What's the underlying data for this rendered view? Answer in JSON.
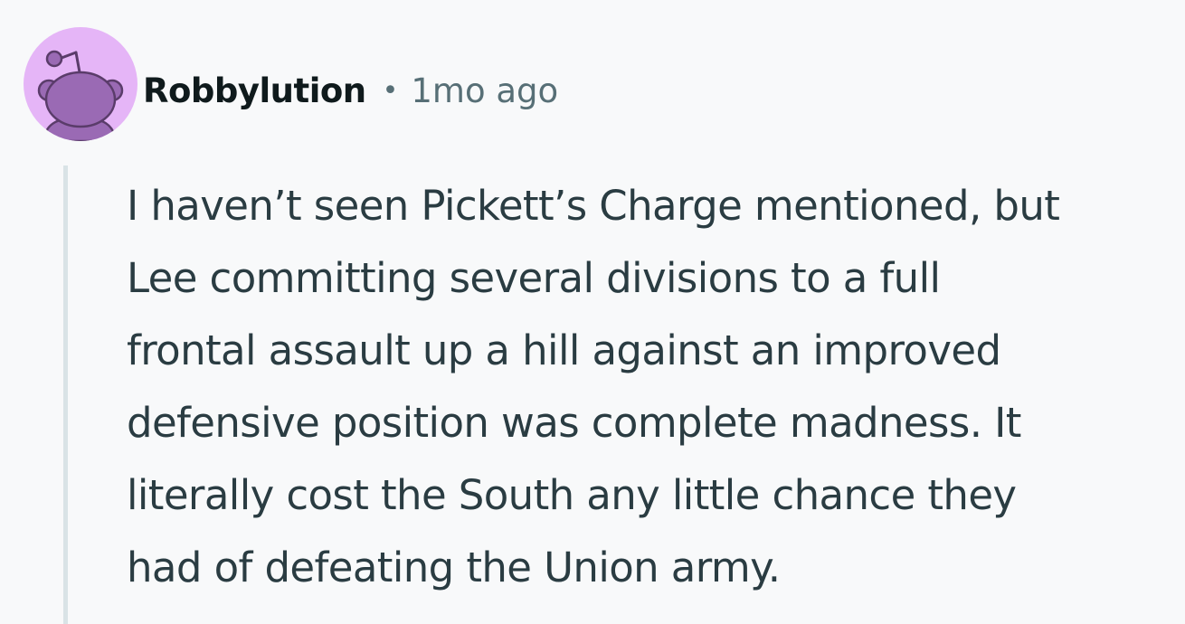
{
  "comment": {
    "author": "Robbylution",
    "separator": "•",
    "timestamp": "1mo ago",
    "body_lines": [
      "I haven’t seen Pickett’s Charge mentioned, but",
      "Lee committing several divisions to a full",
      "frontal assault up a hill against an improved",
      "defensive position was complete madness. It",
      "literally cost the South any little chance they",
      "had of defeating the Union army."
    ]
  },
  "avatar": {
    "icon": "reddit-snoo-avatar-icon",
    "background_color": "#e5b5f7",
    "figure_color": "#9a6ab4"
  },
  "colors": {
    "page_background": "#f8f9fa",
    "author_text": "#0f1a1c",
    "meta_text": "#576f76",
    "body_text": "#2a3c42",
    "thread_line": "#d9e3e6"
  }
}
